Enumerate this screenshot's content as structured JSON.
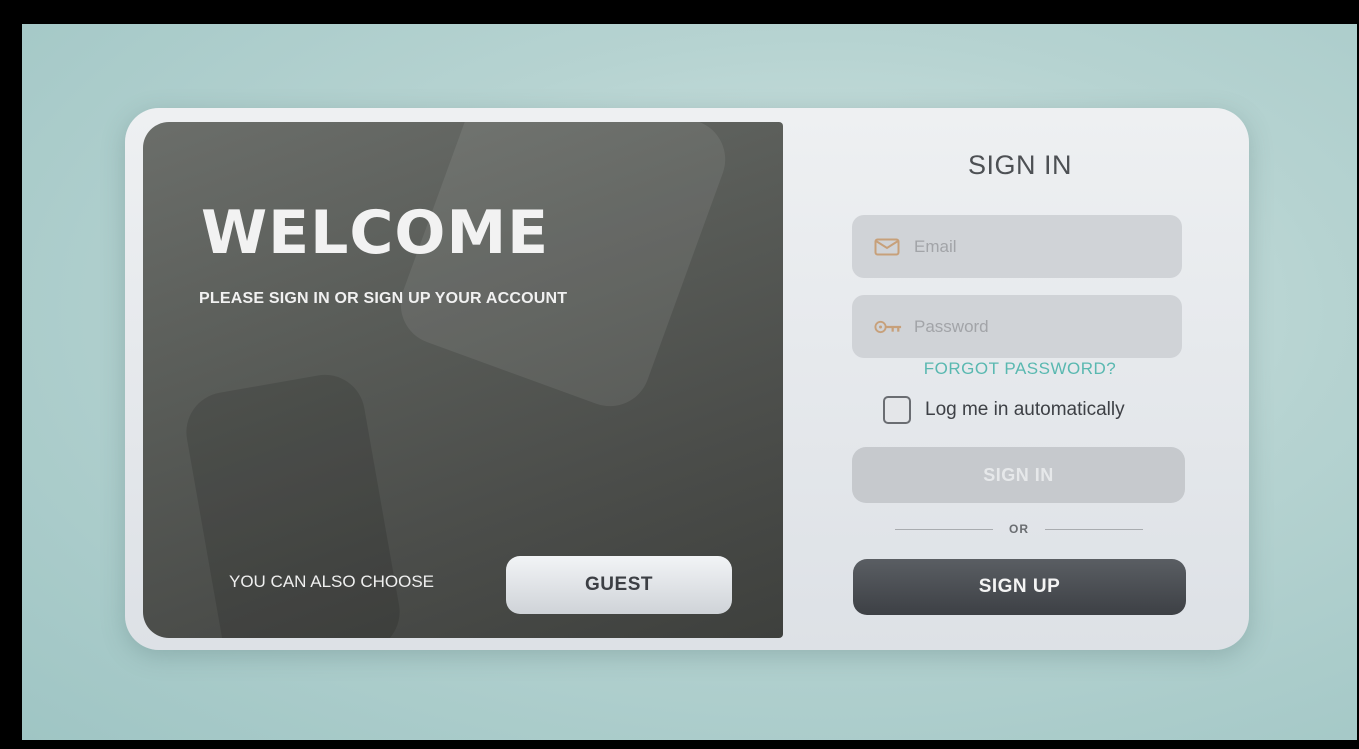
{
  "welcome_panel": {
    "heading": "WELCOME",
    "subtitle": "PLEASE SIGN IN OR SIGN UP YOUR ACCOUNT",
    "choose_text": "YOU CAN ALSO CHOOSE",
    "guest_label": "GUEST"
  },
  "signin_form": {
    "title": "SIGN IN",
    "email": {
      "value": "",
      "placeholder": "Email",
      "icon": "envelope-icon"
    },
    "password": {
      "value": "",
      "placeholder": "Password",
      "icon": "key-icon"
    },
    "forgot_label": "FORGOT PASSWORD?",
    "remember_label": "Log me in automatically",
    "remember_checked": false,
    "signin_label": "SIGN IN",
    "or_label": "OR",
    "signup_label": "SIGN UP"
  },
  "colors": {
    "accent": "#59b8b0",
    "icon": "#c7a07a",
    "primary_button": "#45494e",
    "disabled_button": "#c6c9cd"
  }
}
